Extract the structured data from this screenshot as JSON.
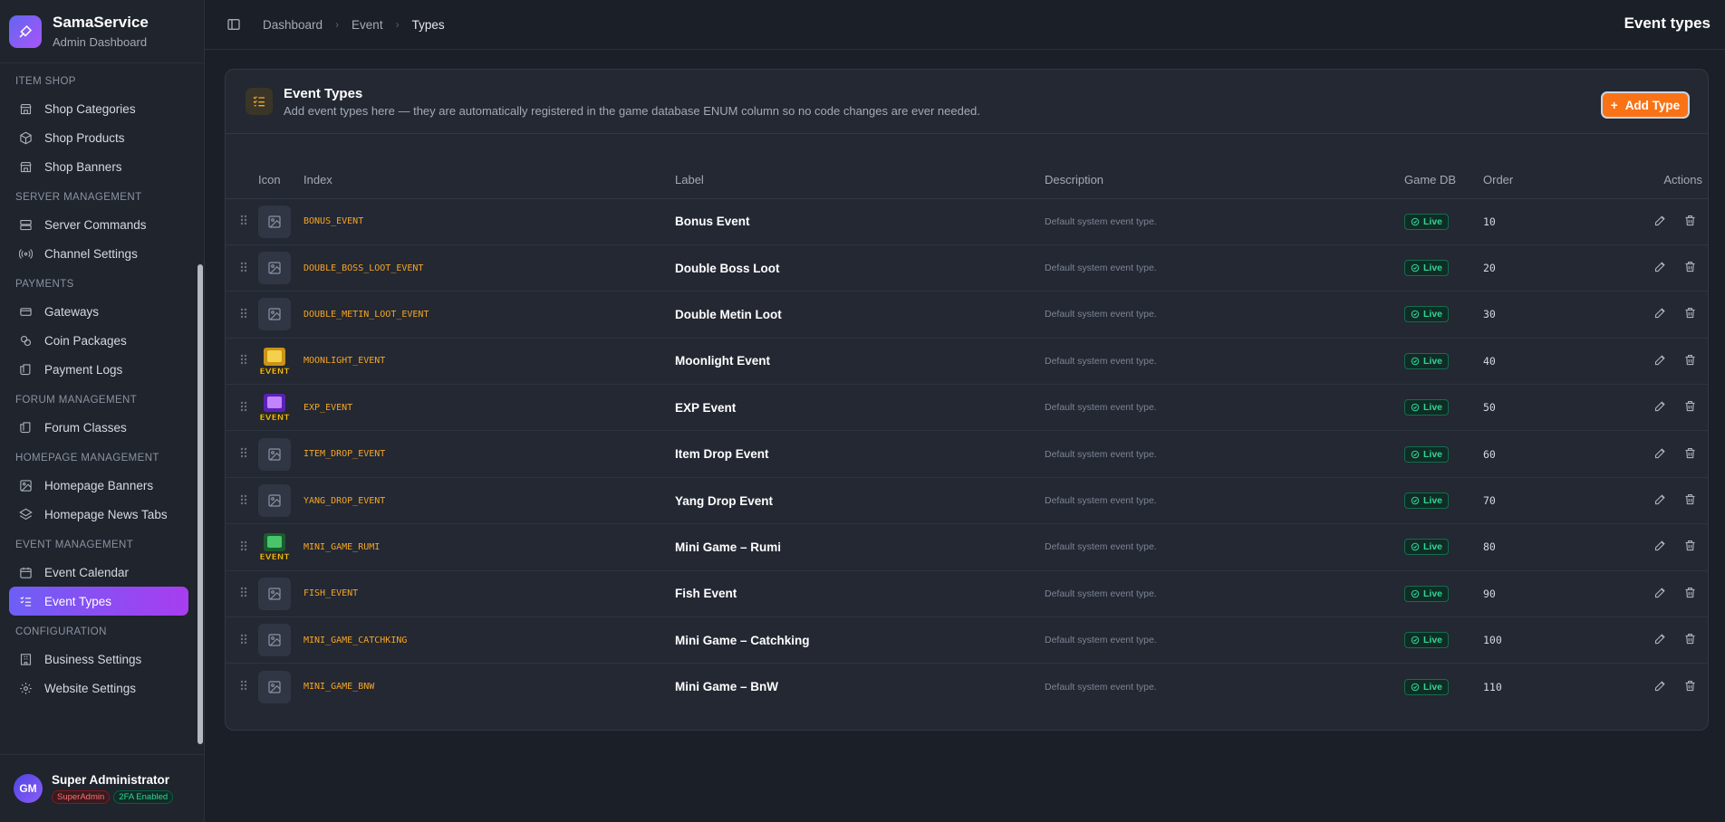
{
  "brand": {
    "title": "SamaService",
    "subtitle": "Admin Dashboard"
  },
  "nav": {
    "sections": [
      {
        "title": "ITEM SHOP",
        "items": [
          {
            "label": "Shop Categories",
            "icon": "store-icon"
          },
          {
            "label": "Shop Products",
            "icon": "box-icon"
          },
          {
            "label": "Shop Banners",
            "icon": "store-icon"
          }
        ]
      },
      {
        "title": "SERVER MANAGEMENT",
        "items": [
          {
            "label": "Server Commands",
            "icon": "server-icon"
          },
          {
            "label": "Channel Settings",
            "icon": "radio-icon"
          }
        ]
      },
      {
        "title": "PAYMENTS",
        "items": [
          {
            "label": "Gateways",
            "icon": "card-icon"
          },
          {
            "label": "Coin Packages",
            "icon": "coins-icon"
          },
          {
            "label": "Payment Logs",
            "icon": "scroll-icon"
          }
        ]
      },
      {
        "title": "FORUM MANAGEMENT",
        "items": [
          {
            "label": "Forum Classes",
            "icon": "scroll-icon"
          }
        ]
      },
      {
        "title": "HOMEPAGE MANAGEMENT",
        "items": [
          {
            "label": "Homepage Banners",
            "icon": "image-icon"
          },
          {
            "label": "Homepage News Tabs",
            "icon": "layers-icon"
          }
        ]
      },
      {
        "title": "EVENT MANAGEMENT",
        "items": [
          {
            "label": "Event Calendar",
            "icon": "calendar-icon"
          },
          {
            "label": "Event Types",
            "icon": "list-icon",
            "active": true
          }
        ]
      },
      {
        "title": "CONFIGURATION",
        "items": [
          {
            "label": "Business Settings",
            "icon": "building-icon"
          },
          {
            "label": "Website Settings",
            "icon": "gear-icon"
          }
        ]
      }
    ]
  },
  "user": {
    "initials": "GM",
    "name": "Super Administrator",
    "role": "SuperAdmin",
    "twofa": "2FA Enabled"
  },
  "header": {
    "breadcrumbs": [
      "Dashboard",
      "Event",
      "Types"
    ],
    "title": "Event types"
  },
  "card": {
    "title": "Event Types",
    "subtitle": "Add event types here — they are automatically registered in the game database ENUM column so no code changes are ever needed.",
    "add_label": "Add Type"
  },
  "table": {
    "columns": {
      "icon": "Icon",
      "index": "Index",
      "label": "Label",
      "description": "Description",
      "gamedb": "Game DB",
      "order": "Order",
      "actions": "Actions"
    },
    "rows": [
      {
        "index": "BONUS_EVENT",
        "label": "Bonus Event",
        "description": "Default system event type.",
        "status": "Live",
        "order": "10",
        "icon": "placeholder"
      },
      {
        "index": "DOUBLE_BOSS_LOOT_EVENT",
        "label": "Double Boss Loot",
        "description": "Default system event type.",
        "status": "Live",
        "order": "20",
        "icon": "placeholder"
      },
      {
        "index": "DOUBLE_METIN_LOOT_EVENT",
        "label": "Double Metin Loot",
        "description": "Default system event type.",
        "status": "Live",
        "order": "30",
        "icon": "placeholder"
      },
      {
        "index": "MOONLIGHT_EVENT",
        "label": "Moonlight Event",
        "description": "Default system event type.",
        "status": "Live",
        "order": "40",
        "icon": "gold",
        "icon_text": "EVENT"
      },
      {
        "index": "EXP_EVENT",
        "label": "EXP Event",
        "description": "Default system event type.",
        "status": "Live",
        "order": "50",
        "icon": "purple",
        "icon_text": "EVENT"
      },
      {
        "index": "ITEM_DROP_EVENT",
        "label": "Item Drop Event",
        "description": "Default system event type.",
        "status": "Live",
        "order": "60",
        "icon": "placeholder"
      },
      {
        "index": "YANG_DROP_EVENT",
        "label": "Yang Drop Event",
        "description": "Default system event type.",
        "status": "Live",
        "order": "70",
        "icon": "placeholder"
      },
      {
        "index": "MINI_GAME_RUMI",
        "label": "Mini Game – Rumi",
        "description": "Default system event type.",
        "status": "Live",
        "order": "80",
        "icon": "green",
        "icon_text": "EVENT"
      },
      {
        "index": "FISH_EVENT",
        "label": "Fish Event",
        "description": "Default system event type.",
        "status": "Live",
        "order": "90",
        "icon": "placeholder"
      },
      {
        "index": "MINI_GAME_CATCHKING",
        "label": "Mini Game – Catchking",
        "description": "Default system event type.",
        "status": "Live",
        "order": "100",
        "icon": "placeholder"
      },
      {
        "index": "MINI_GAME_BNW",
        "label": "Mini Game – BnW",
        "description": "Default system event type.",
        "status": "Live",
        "order": "110",
        "icon": "placeholder"
      }
    ]
  }
}
